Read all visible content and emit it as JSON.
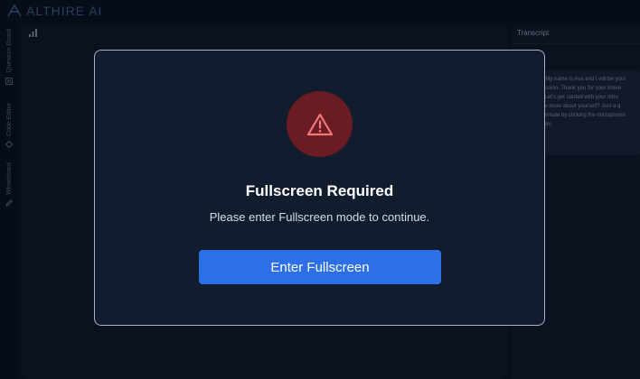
{
  "header": {
    "brand": "ALTHIRE AI"
  },
  "sidebar": {
    "items": [
      {
        "label": "Question Board",
        "icon": "board-icon"
      },
      {
        "label": "Code Editor",
        "icon": "code-icon"
      },
      {
        "label": "Whiteboard",
        "icon": "pen-icon"
      }
    ]
  },
  "transcript": {
    "title": "Transcript",
    "lines": [
      "arja - My name is Ava and I will be your",
      "y's session. Thank you for your intere",
      "ition. Let's get started with your intro",
      "tell me more about yourself? Just a q",
      "can unmute by clicking the microphone",
      "r screen."
    ]
  },
  "modal": {
    "title": "Fullscreen Required",
    "message": "Please enter Fullscreen mode to continue.",
    "button_label": "Enter Fullscreen"
  },
  "colors": {
    "accent": "#2d6fe6",
    "warning_bg": "#6b1b22",
    "warning_icon": "#f07a7a"
  }
}
